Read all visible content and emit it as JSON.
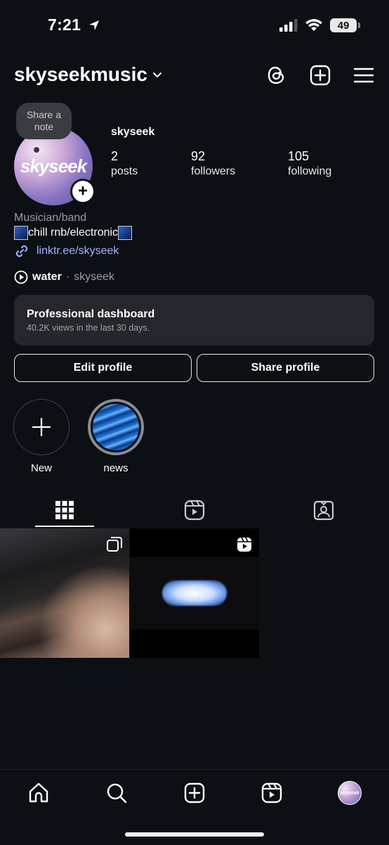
{
  "status_bar": {
    "time": "7:21",
    "battery": "49"
  },
  "header": {
    "username": "skyseek"
  },
  "note": {
    "text": "Share a note"
  },
  "avatar": {
    "logo_text": "skyseek"
  },
  "profile": {
    "name": "skyseek",
    "stats": [
      {
        "value": "2",
        "label": "posts"
      },
      {
        "value": "92",
        "label": "followers"
      },
      {
        "value": "105",
        "label": "following"
      }
    ],
    "category": "Musician/band",
    "bio": "chill rnb/electronic",
    "link": "linktr.ee/skyseek",
    "music": {
      "title": "water",
      "separator": "·",
      "artist": "skyseek"
    }
  },
  "dashboard": {
    "title": "Professional dashboard",
    "subtitle": "40.2K views in the last 30 days."
  },
  "buttons": {
    "edit": "Edit profile",
    "share": "Share profile"
  },
  "highlights": [
    {
      "label": "New"
    },
    {
      "label": "news"
    }
  ],
  "bottom_nav": {
    "avatar_text": "skyseek"
  },
  "colors": {
    "background": "#0c0f14",
    "link": "#a6b4ff",
    "card": "#25272c"
  }
}
